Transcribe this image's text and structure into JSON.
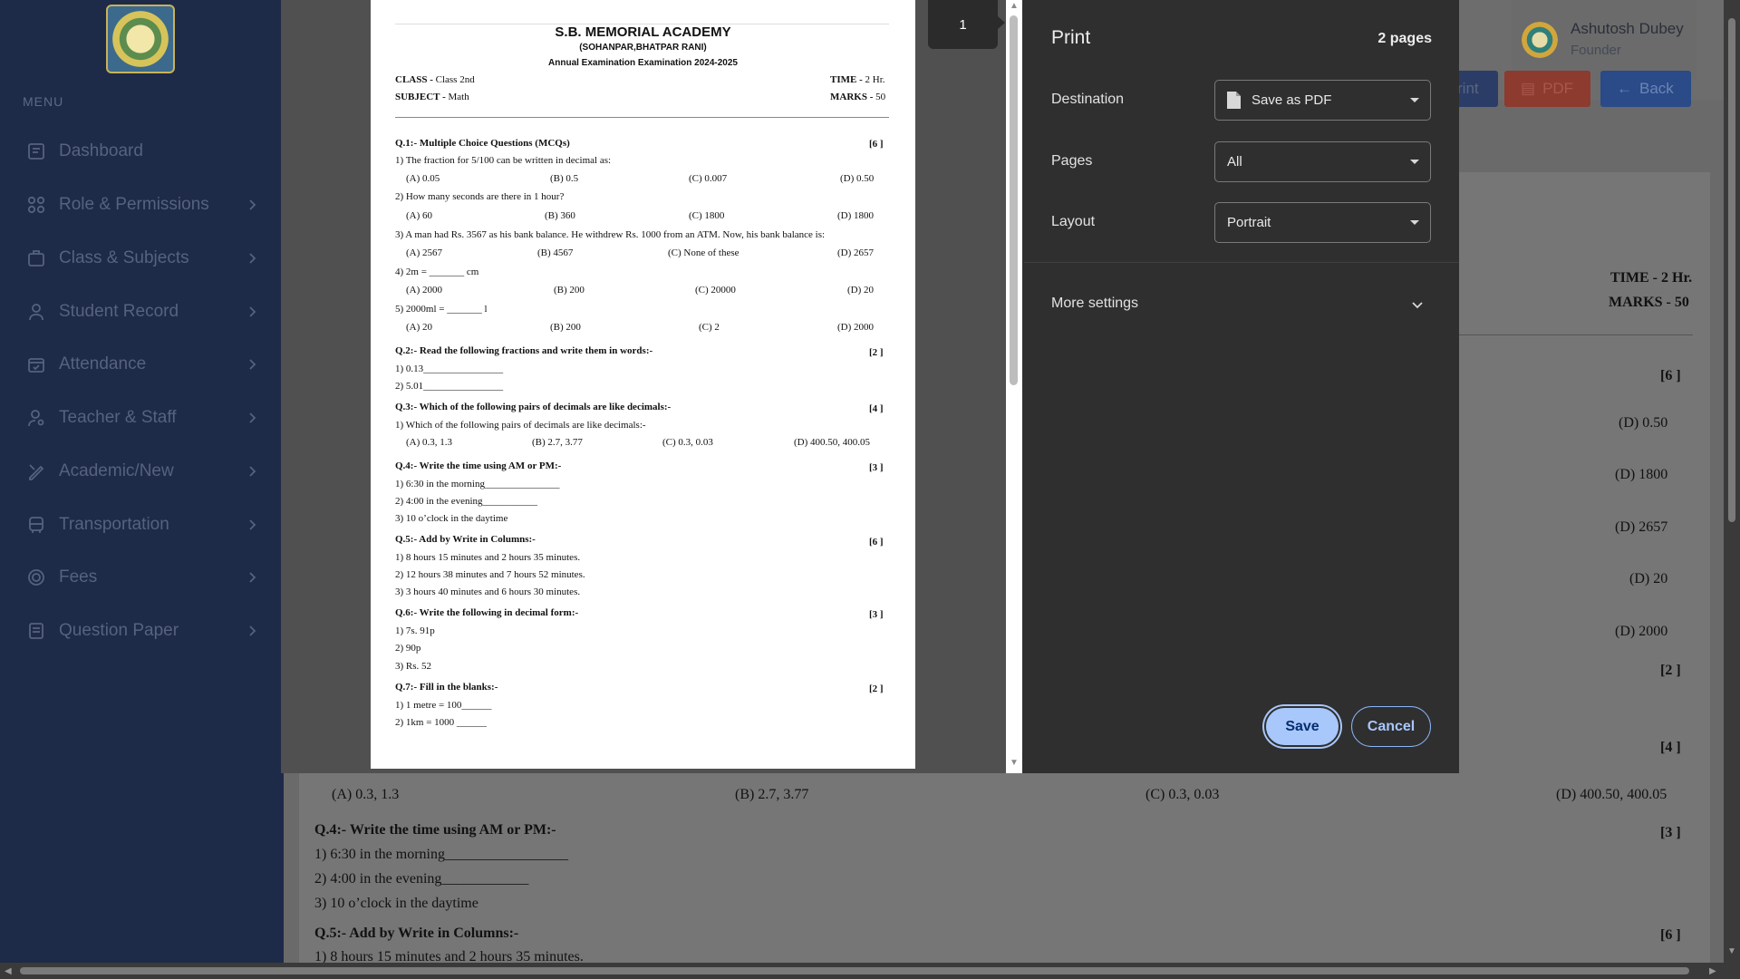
{
  "sidebar": {
    "menu_title": "MENU",
    "items": [
      {
        "label": "Dashboard",
        "icon": "dashboard-icon"
      },
      {
        "label": "Role & Permissions",
        "icon": "grid-icon"
      },
      {
        "label": "Class & Subjects",
        "icon": "briefcase-icon"
      },
      {
        "label": "Student Record",
        "icon": "user-icon"
      },
      {
        "label": "Attendance",
        "icon": "calendar-icon"
      },
      {
        "label": "Teacher & Staff",
        "icon": "user-settings-icon"
      },
      {
        "label": "Academic/New",
        "icon": "pencil-ruler-icon"
      },
      {
        "label": "Transportation",
        "icon": "bus-icon"
      },
      {
        "label": "Fees",
        "icon": "coin-icon"
      },
      {
        "label": "Question Paper",
        "icon": "document-icon"
      }
    ]
  },
  "profile": {
    "name": "Ashutosh Dubey",
    "role": "Founder"
  },
  "bg_buttons": {
    "print": "rint",
    "pdf": "PDF",
    "back": "Back"
  },
  "bg_paper": {
    "time": "TIME - 2 Hr.",
    "marks": "MARKS - 50",
    "m1": "[6 ]",
    "r1": "(D) 0.50",
    "r2": "(D) 1800",
    "r3": "(D) 2657",
    "r4": "(D) 20",
    "r5": "(D) 2000",
    "m2": "[2 ]",
    "m3": "[4 ]",
    "q3_opts": [
      "(A) 0.3, 1.3",
      "(B) 2.7, 3.77",
      "(C) 0.3, 0.03",
      "(D) 400.50, 400.05"
    ],
    "q4_head": "Q.4:- Write the time using AM or PM:-",
    "m4": "[3 ]",
    "q4_items": [
      "1) 6:30 in the morning_________________",
      "2) 4:00 in the evening____________",
      "3) 10 o’clock in the daytime"
    ],
    "q5_head": "Q.5:- Add by Write in Columns:-",
    "m5": "[6 ]",
    "q5_first": "1) 8 hours 15 minutes and 2 hours 35 minutes."
  },
  "preview": {
    "page_number": "1",
    "school_name": "S.B. MEMORIAL ACADEMY",
    "school_address": "(SOHANPAR,BHATPAR RANI)",
    "exam_title": "Annual Examination Examination 2024-2025",
    "class_label": "CLASS -",
    "class_value": "Class 2nd",
    "subject_label": "SUBJECT -",
    "subject_value": "Math",
    "time_label": "TIME -",
    "time_value": "2 Hr.",
    "marks_label": "MARKS -",
    "marks_value": "50",
    "q1": {
      "head": "Q.1:- Multiple Choice Questions (MCQs)",
      "marks": "[6 ]"
    },
    "q1_1": "1) The fraction for 5/100 can be written in decimal as:",
    "q1_1_opts": [
      "(A) 0.05",
      "(B) 0.5",
      "(C) 0.007",
      "(D) 0.50"
    ],
    "q1_2": "2) How many seconds are there in 1 hour?",
    "q1_2_opts": [
      "(A) 60",
      "(B) 360",
      "(C) 1800",
      "(D) 1800"
    ],
    "q1_3": "3) A man had Rs. 3567 as his bank balance. He withdrew Rs. 1000 from an ATM. Now, his bank balance is:",
    "q1_3_opts": [
      "(A) 2567",
      "(B) 4567",
      "(C) None of these",
      "(D) 2657"
    ],
    "q1_4": "4) 2m = _______ cm",
    "q1_4_opts": [
      "(A) 2000",
      "(B) 200",
      "(C) 20000",
      "(D) 20"
    ],
    "q1_5": "5) 2000ml = _______ l",
    "q1_5_opts": [
      "(A) 20",
      "(B) 200",
      "(C) 2",
      "(D) 2000"
    ],
    "q2": {
      "head": "Q.2:- Read the following fractions and write them in words:-",
      "marks": "[2 ]"
    },
    "q2_items": [
      "1) 0.13________________",
      "2) 5.01________________"
    ],
    "q3": {
      "head": "Q.3:- Which of the following pairs of decimals are like decimals:-",
      "marks": "[4 ]"
    },
    "q3_1": "1) Which of the following pairs of decimals are like decimals:-",
    "q3_1_opts": [
      "(A) 0.3, 1.3",
      "(B) 2.7, 3.77",
      "(C) 0.3, 0.03",
      "(D) 400.50, 400.05"
    ],
    "q4": {
      "head": "Q.4:- Write the time using AM or PM:-",
      "marks": "[3 ]"
    },
    "q4_items": [
      "1) 6:30 in the morning_______________",
      "2) 4:00 in the evening___________",
      "3) 10 o’clock in the daytime"
    ],
    "q5": {
      "head": "Q.5:- Add by Write in Columns:-",
      "marks": "[6 ]"
    },
    "q5_items": [
      "1) 8 hours 15 minutes and 2 hours 35 minutes.",
      "2) 12 hours 38 minutes and 7 hours 52 minutes.",
      "3) 3 hours 40 minutes and 6 hours 30 minutes."
    ],
    "q6": {
      "head": "Q.6:- Write the following in decimal form:-",
      "marks": "[3 ]"
    },
    "q6_items": [
      "1) 7s. 91p",
      "2) 90p",
      "3) Rs. 52"
    ],
    "q7": {
      "head": "Q.7:- Fill in the blanks:-",
      "marks": "[2 ]"
    },
    "q7_items": [
      "1) 1 metre = 100______",
      "2) 1km = 1000 ______"
    ]
  },
  "print_panel": {
    "title": "Print",
    "page_count": "2 pages",
    "destination_label": "Destination",
    "destination_value": "Save as PDF",
    "pages_label": "Pages",
    "pages_value": "All",
    "layout_label": "Layout",
    "layout_value": "Portrait",
    "more_settings": "More settings",
    "save": "Save",
    "cancel": "Cancel"
  },
  "colors": {
    "sidebar": "#1d2a48",
    "panel": "#2f2f2f",
    "save_button": "#a8c7fa",
    "cancel_border": "#8ab4f8"
  }
}
